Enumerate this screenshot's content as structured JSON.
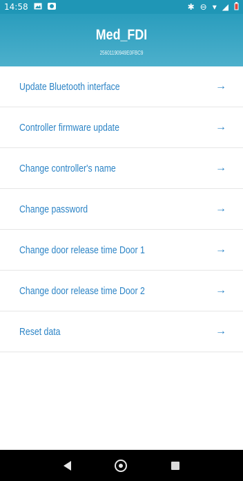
{
  "status_bar": {
    "time": "14:58",
    "left_icons": [
      "image-icon",
      "notification-icon"
    ],
    "right_icons": [
      "bluetooth-icon",
      "do-not-disturb-icon",
      "wifi-icon",
      "signal-icon",
      "battery-icon"
    ]
  },
  "header": {
    "title": "Med_FDI",
    "subtitle": "25601190949E0FBC9"
  },
  "menu": {
    "items": [
      {
        "label": "Update Bluetooth interface",
        "icon": "arrow-right-icon"
      },
      {
        "label": "Controller firmware update",
        "icon": "arrow-right-icon"
      },
      {
        "label": "Change controller's name",
        "icon": "arrow-right-icon"
      },
      {
        "label": "Change password",
        "icon": "arrow-right-icon"
      },
      {
        "label": "Change door release time Door 1",
        "icon": "arrow-right-icon"
      },
      {
        "label": "Change door release time Door 2",
        "icon": "arrow-right-icon"
      },
      {
        "label": "Reset data",
        "icon": "arrow-right-icon"
      }
    ]
  },
  "nav_bar": {
    "buttons": [
      "back-icon",
      "home-icon",
      "recent-apps-icon"
    ]
  },
  "colors": {
    "accent": "#2c84c6",
    "header": "#2a9dbd",
    "status_bar": "#1f96b6",
    "nav_bar": "#000000"
  }
}
